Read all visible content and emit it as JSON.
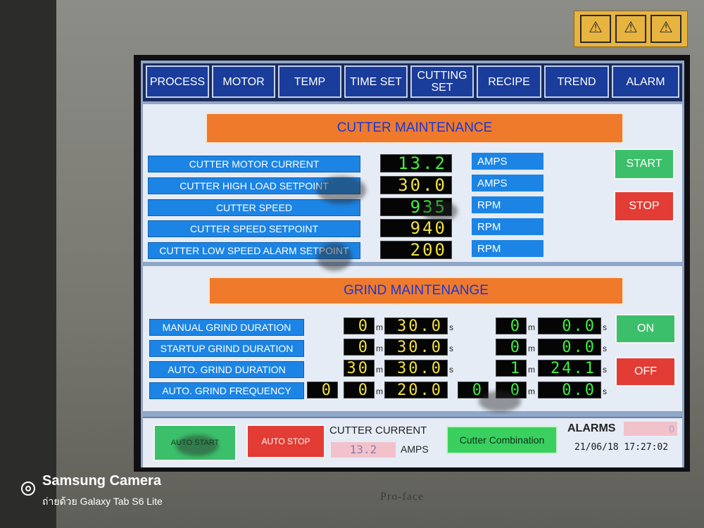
{
  "tabs": [
    {
      "label": "PROCESS"
    },
    {
      "label": "MOTOR"
    },
    {
      "label": "TEMP"
    },
    {
      "label": "TIME SET"
    },
    {
      "label_line1": "CUTTING",
      "label_line2": "SET"
    },
    {
      "label": "RECIPE"
    },
    {
      "label": "TREND"
    },
    {
      "label": "ALARM"
    }
  ],
  "cutter": {
    "title": "CUTTER MAINTENANCE",
    "rows": [
      {
        "label": "CUTTER MOTOR CURRENT",
        "value": "13.2",
        "unit": "AMPS"
      },
      {
        "label": "CUTTER HIGH LOAD SETPOINT",
        "value": "30.0",
        "unit": "AMPS"
      },
      {
        "label": "CUTTER SPEED",
        "value": "935",
        "unit": "RPM"
      },
      {
        "label": "CUTTER SPEED SETPOINT",
        "value": "940",
        "unit": "RPM"
      },
      {
        "label": "CUTTER LOW SPEED ALARM SETPOINT",
        "value": "200",
        "unit": "RPM"
      }
    ],
    "start_label": "START",
    "stop_label": "STOP"
  },
  "grind": {
    "title": "GRIND MAINTENANGE",
    "m": "m",
    "s": "s",
    "rows": [
      {
        "label": "MANUAL GRIND DURATION",
        "set_min": "0",
        "set_sec": "30.0",
        "act_min": "0",
        "act_sec": "0.0"
      },
      {
        "label": "STARTUP GRIND DURATION",
        "set_min": "0",
        "set_sec": "30.0",
        "act_min": "0",
        "act_sec": "0.0"
      },
      {
        "label": "AUTO. GRIND DURATION",
        "set_min": "30",
        "set_sec": "30.0",
        "act_min": "1",
        "act_sec": "24.1"
      },
      {
        "label": "AUTO. GRIND FREQUENCY",
        "set_hr": "0",
        "set_min": "0",
        "set_sec": "20.0",
        "act_hr": "0",
        "act_min": "0",
        "act_sec": "0.0"
      }
    ],
    "on_label": "ON",
    "off_label": "OFF"
  },
  "bottom": {
    "auto_start": "AUTO START",
    "auto_stop": "AUTO STOP",
    "current_title": "CUTTER CURRENT",
    "current_value": "13.2",
    "current_unit": "AMPS",
    "combination": "Cutter Combination",
    "alarms_title": "ALARMS",
    "alarms_value": "0",
    "datetime": "21/06/18 17:27:02"
  },
  "device": {
    "brand": "Pro-face"
  },
  "watermark": {
    "title": "Samsung Camera",
    "subtitle": "ถ่ายด้วย Galaxy Tab S6 Lite"
  },
  "colors": {
    "tab_bg": "#1a3c9a",
    "section_bar": "#ef7a2c",
    "label_bg": "#1c84e4",
    "setpoint_text": "#f2e23a",
    "actual_text": "#3ef23a",
    "start_green": "#3cbf6a",
    "stop_red": "#e23c34"
  }
}
